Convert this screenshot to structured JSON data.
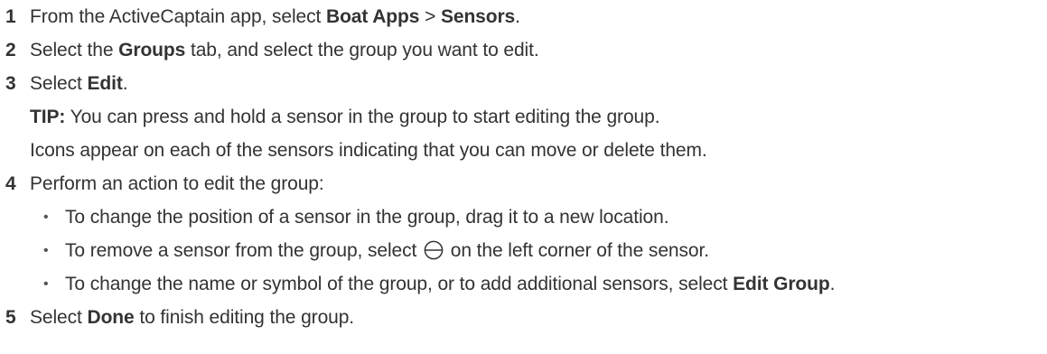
{
  "steps": [
    {
      "number": "1",
      "parts": [
        "From the ActiveCaptain app, select ",
        "Boat Apps",
        " > ",
        "Sensors",
        "."
      ]
    },
    {
      "number": "2",
      "parts": [
        "Select the ",
        "Groups",
        " tab, and select the group you want to edit."
      ]
    },
    {
      "number": "3",
      "parts": [
        "Select ",
        "Edit",
        "."
      ],
      "tip_label": "TIP:",
      "tip_text": " You can press and hold a sensor in the group to start editing the group.",
      "note": "Icons appear on each of the sensors indicating that you can move or delete them."
    },
    {
      "number": "4",
      "text": "Perform an action to edit the group:",
      "bullets": [
        {
          "text": "To change the position of a sensor in the group, drag it to a new location."
        },
        {
          "before": "To remove a sensor from the group, select ",
          "icon": "minus-circle-icon",
          "after": " on the left corner of the sensor."
        },
        {
          "before": "To change the name or symbol of the group, or to add additional sensors, select ",
          "bold": "Edit Group",
          "after": "."
        }
      ]
    },
    {
      "number": "5",
      "parts": [
        "Select ",
        "Done",
        " to finish editing the group."
      ]
    }
  ],
  "bullet_char": "•"
}
